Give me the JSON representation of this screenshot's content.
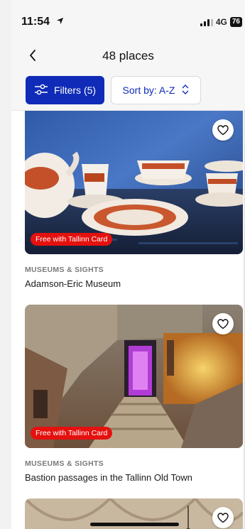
{
  "status_bar": {
    "time": "11:54",
    "network": "4G",
    "battery": "76"
  },
  "header": {
    "title": "48 places"
  },
  "toolbar": {
    "filters_label": "Filters (5)",
    "sort_label": "Sort by: A-Z"
  },
  "places": [
    {
      "category": "MUSEUMS & SIGHTS",
      "name": "Adamson-Eric Museum",
      "badge": "Free with Tallinn Card"
    },
    {
      "category": "MUSEUMS & SIGHTS",
      "name": "Bastion passages in the Tallinn Old Town",
      "badge": "Free with Tallinn Card"
    }
  ],
  "colors": {
    "accent": "#0f2bb8",
    "badge": "#e4110f"
  }
}
